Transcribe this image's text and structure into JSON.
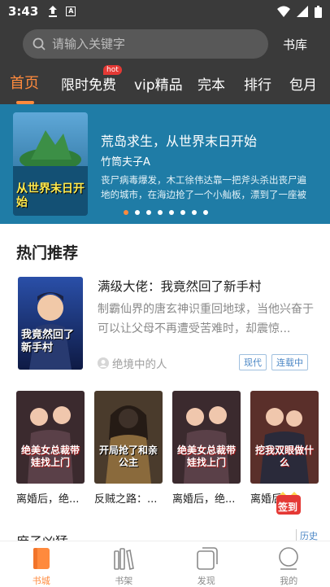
{
  "status_bar": {
    "time": "3:43",
    "icons": [
      "upload-icon",
      "a-icon",
      "wifi-icon",
      "signal-icon",
      "battery-icon"
    ]
  },
  "header": {
    "search_placeholder": "请输入关键字",
    "library_label": "书库"
  },
  "tabs": [
    {
      "label": "首页",
      "active": true
    },
    {
      "label": "限时免费",
      "badge": "hot"
    },
    {
      "label": "vip精品"
    },
    {
      "label": "完本"
    },
    {
      "label": "排行"
    },
    {
      "label": "包月"
    }
  ],
  "banner": {
    "title": "荒岛求生，从世界末日开始",
    "author": "竹筒夫子A",
    "description": "丧尸病毒爆发，木工徐伟达靠一把斧头杀出丧尸遍地的城市，在海边抢了一个小舢板，漂到了一座被人...",
    "dots_count": 8,
    "active_dot": 0,
    "cover_text": "从世界末日开始"
  },
  "hot_section": {
    "title": "热门推荐",
    "featured": {
      "title": "满级大佬：我竟然回了新手村",
      "description": "制霸仙界的唐玄神识重回地球，当他兴奋于可以让父母不再遭受苦难时，却震惊...",
      "author": "绝境中的人",
      "tags": [
        "现代",
        "连载中"
      ],
      "cover_text": "我竟然回了新手村"
    },
    "books": [
      {
        "title": "离婚后，绝...",
        "cover_text": "绝美女总裁带娃找上门"
      },
      {
        "title": "反贼之路：...",
        "cover_text": "开局抢了和亲公主"
      },
      {
        "title": "离婚后，绝...",
        "cover_text": "绝美女总裁带娃找上门"
      },
      {
        "title": "离婚后...",
        "cover_text": "挖我双眼做什么"
      }
    ]
  },
  "next_section": {
    "title": "庶子凶猛",
    "history_label": "历史"
  },
  "signin_badge": "签到",
  "bottom_nav": [
    {
      "label": "书城",
      "icon": "bookstore-icon",
      "active": true
    },
    {
      "label": "书架",
      "icon": "bookshelf-icon"
    },
    {
      "label": "发现",
      "icon": "discover-icon"
    },
    {
      "label": "我的",
      "icon": "profile-icon"
    }
  ],
  "colors": {
    "accent": "#ff8a3d",
    "header_bg": "#3a3a3a",
    "banner_bg": "#1f7ca6",
    "tag_blue": "#4a86c5"
  }
}
